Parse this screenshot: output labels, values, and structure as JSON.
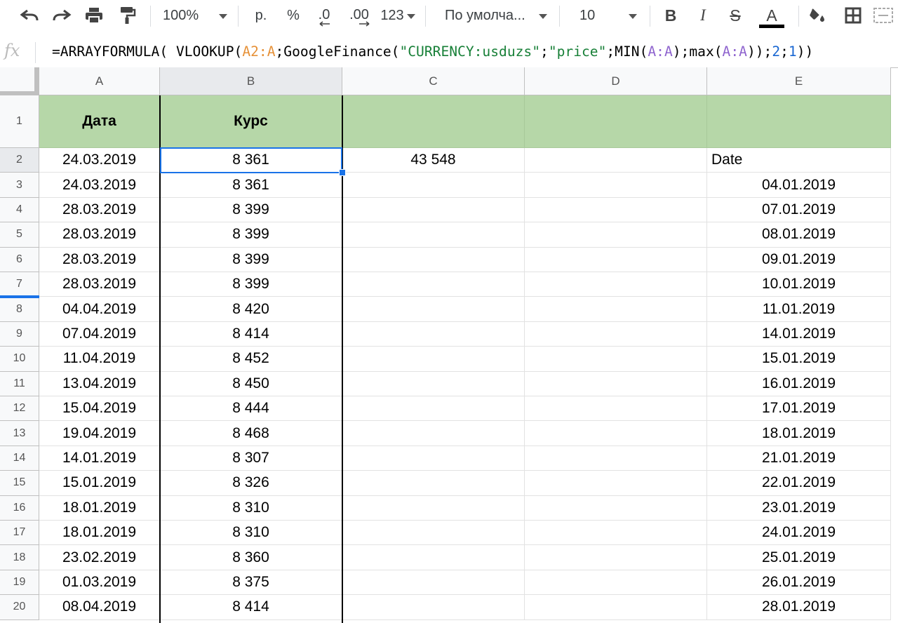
{
  "toolbar": {
    "zoom": "100%",
    "currency": "р.",
    "percent": "%",
    "dec_decrease": ".0",
    "dec_increase": ".00",
    "more_formats": "123",
    "font": "По умолча...",
    "font_size": "10",
    "bold": "B",
    "italic": "I",
    "strike": "S",
    "text_color": "A"
  },
  "formula_bar": {
    "fx": "fx",
    "parts": [
      {
        "t": "=ARRAYFORMULA( VLOOKUP(",
        "c": "#000000"
      },
      {
        "t": "A2:A",
        "c": "#e69138"
      },
      {
        "t": ";GoogleFinance(",
        "c": "#000000"
      },
      {
        "t": "\"CURRENCY:usduzs\"",
        "c": "#188038"
      },
      {
        "t": ";",
        "c": "#000000"
      },
      {
        "t": "\"price\"",
        "c": "#188038"
      },
      {
        "t": ";MIN(",
        "c": "#000000"
      },
      {
        "t": "A:A",
        "c": "#8e63ce"
      },
      {
        "t": ");max(",
        "c": "#000000"
      },
      {
        "t": "A:A",
        "c": "#8e63ce"
      },
      {
        "t": "));",
        "c": "#000000"
      },
      {
        "t": "2",
        "c": "#1967d2"
      },
      {
        "t": ";",
        "c": "#000000"
      },
      {
        "t": "1",
        "c": "#1967d2"
      },
      {
        "t": "))",
        "c": "#000000"
      }
    ]
  },
  "columns": [
    "A",
    "B",
    "C",
    "D",
    "E"
  ],
  "header_row": {
    "row": "1",
    "A": "Дата",
    "B": "Курс",
    "C": "",
    "D": "",
    "E": ""
  },
  "rows": [
    {
      "row": "2",
      "A": "24.03.2019",
      "B": "8 361",
      "C": "43 548",
      "D": "",
      "E": "Date"
    },
    {
      "row": "3",
      "A": "24.03.2019",
      "B": "8 361",
      "C": "",
      "D": "",
      "E": "04.01.2019"
    },
    {
      "row": "4",
      "A": "28.03.2019",
      "B": "8 399",
      "C": "",
      "D": "",
      "E": "07.01.2019"
    },
    {
      "row": "5",
      "A": "28.03.2019",
      "B": "8 399",
      "C": "",
      "D": "",
      "E": "08.01.2019"
    },
    {
      "row": "6",
      "A": "28.03.2019",
      "B": "8 399",
      "C": "",
      "D": "",
      "E": "09.01.2019"
    },
    {
      "row": "7",
      "A": "28.03.2019",
      "B": "8 399",
      "C": "",
      "D": "",
      "E": "10.01.2019"
    },
    {
      "row": "8",
      "A": "04.04.2019",
      "B": "8 420",
      "C": "",
      "D": "",
      "E": "11.01.2019"
    },
    {
      "row": "9",
      "A": "07.04.2019",
      "B": "8 414",
      "C": "",
      "D": "",
      "E": "14.01.2019"
    },
    {
      "row": "10",
      "A": "11.04.2019",
      "B": "8 452",
      "C": "",
      "D": "",
      "E": "15.01.2019"
    },
    {
      "row": "11",
      "A": "13.04.2019",
      "B": "8 450",
      "C": "",
      "D": "",
      "E": "16.01.2019"
    },
    {
      "row": "12",
      "A": "15.04.2019",
      "B": "8 444",
      "C": "",
      "D": "",
      "E": "17.01.2019"
    },
    {
      "row": "13",
      "A": "19.04.2019",
      "B": "8 468",
      "C": "",
      "D": "",
      "E": "18.01.2019"
    },
    {
      "row": "14",
      "A": "14.01.2019",
      "B": "8 307",
      "C": "",
      "D": "",
      "E": "21.01.2019"
    },
    {
      "row": "15",
      "A": "15.01.2019",
      "B": "8 326",
      "C": "",
      "D": "",
      "E": "22.01.2019"
    },
    {
      "row": "16",
      "A": "18.01.2019",
      "B": "8 310",
      "C": "",
      "D": "",
      "E": "23.01.2019"
    },
    {
      "row": "17",
      "A": "18.01.2019",
      "B": "8 310",
      "C": "",
      "D": "",
      "E": "24.01.2019"
    },
    {
      "row": "18",
      "A": "23.02.2019",
      "B": "8 360",
      "C": "",
      "D": "",
      "E": "25.01.2019"
    },
    {
      "row": "19",
      "A": "01.03.2019",
      "B": "8 375",
      "C": "",
      "D": "",
      "E": "26.01.2019"
    },
    {
      "row": "20",
      "A": "08.04.2019",
      "B": "8 414",
      "C": "",
      "D": "",
      "E": "28.01.2019"
    }
  ],
  "selected_cell": "B2",
  "colors": {
    "header_fill": "#b6d7a8",
    "selection": "#1a73e8"
  }
}
